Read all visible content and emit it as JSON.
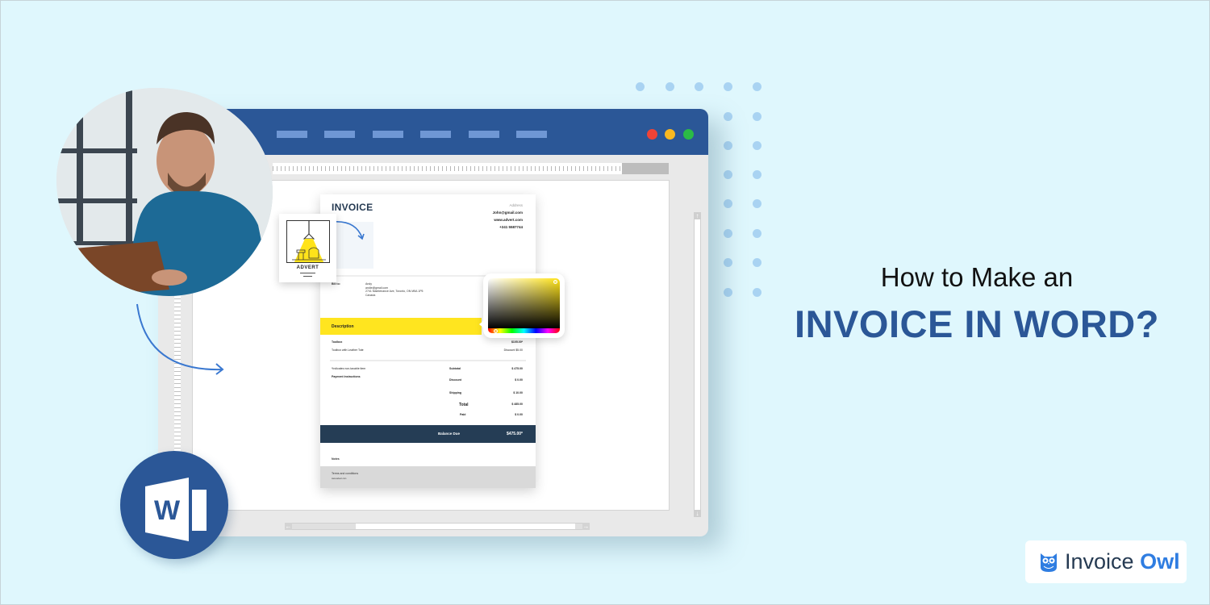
{
  "headline": {
    "line1": "How to Make an",
    "line2": "INVOICE IN WORD?"
  },
  "brand": {
    "icon": "owl-icon",
    "name_part1": "Invoice",
    "name_part2": "Owl",
    "accent_color": "#2f7de1"
  },
  "word_window": {
    "titlebar_color": "#2b5797",
    "menu_items_count": 6,
    "window_controls": [
      {
        "name": "close",
        "color": "#f04336"
      },
      {
        "name": "minimize",
        "color": "#f9b820"
      },
      {
        "name": "maximize",
        "color": "#2bbb46"
      }
    ],
    "scroll_up_icon": "↑",
    "scroll_down_icon": "↓",
    "scroll_left_icon": "←",
    "scroll_right_icon": "→"
  },
  "invoice": {
    "title": "INVOICE",
    "contact": {
      "address": "Address",
      "email": "John@gmail.com",
      "website": "www.advert.com",
      "phone": "+241 5587744"
    },
    "bill_to": {
      "label": "Bill to:",
      "name": "Andy",
      "email": "andie@gmail.com",
      "address": "2741 Maintenance Ave, Toronto, ON M5A 1P5",
      "country": "Canada"
    },
    "description_header": "Description",
    "items": [
      {
        "name": "Toolbox",
        "value": "$105.00*"
      },
      {
        "name": "Toolbox with Leather Tote",
        "value": "Discount $5.00"
      }
    ],
    "notes_left": [
      "*Indicates non-taxable item",
      "Payment Instructions"
    ],
    "summary": [
      {
        "label": "Subtotal",
        "value": "$ 475.00"
      },
      {
        "label": "Discount",
        "value": "$ 0.00"
      },
      {
        "label": "Shipping",
        "value": "$ 10.00"
      },
      {
        "label": "Total",
        "value": "$ 485.00"
      },
      {
        "label": "Paid",
        "value": "$ 0.00"
      }
    ],
    "balance_due_label": "Balance Due",
    "balance_due_value": "$475.00*",
    "notes_label": "Notes",
    "terms_label": "Terms and conditions",
    "terms_text": "www.advert.com"
  },
  "advert_card": {
    "label": "ADVERT"
  },
  "color_picker": {
    "selected_color": "#ffe31a"
  },
  "decor": {
    "word_logo_letter": "W",
    "dots_color": "#a9d3f2"
  }
}
